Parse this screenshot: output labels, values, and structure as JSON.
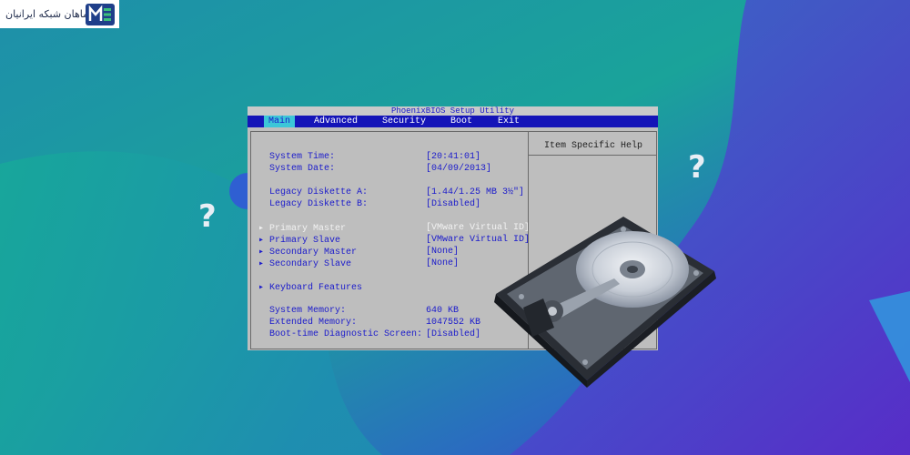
{
  "logo": {
    "text": "ماهان شبکه ایرانیان"
  },
  "bios": {
    "title": "PhoenixBIOS Setup Utility",
    "menu": [
      "Main",
      "Advanced",
      "Security",
      "Boot",
      "Exit"
    ],
    "help_title": "Item Specific Help",
    "rows": [
      {
        "label": "System Time:",
        "value": "[20:41:01]"
      },
      {
        "label": "System Date:",
        "value": "[04/09/2013]"
      },
      {
        "label": "Legacy Diskette A:",
        "value": "[1.44/1.25 MB  3½\"]"
      },
      {
        "label": "Legacy Diskette B:",
        "value": "[Disabled]"
      },
      {
        "label": "Primary Master",
        "value": "[VMware Virtual ID]"
      },
      {
        "label": "Primary Slave",
        "value": "[VMware Virtual ID]"
      },
      {
        "label": "Secondary Master",
        "value": "[None]"
      },
      {
        "label": "Secondary Slave",
        "value": "[None]"
      },
      {
        "label": "Keyboard Features",
        "value": ""
      },
      {
        "label": "System Memory:",
        "value": "640 KB"
      },
      {
        "label": "Extended Memory:",
        "value": "1047552 KB"
      },
      {
        "label": "Boot-time Diagnostic Screen:",
        "value": "[Disabled]"
      }
    ]
  },
  "colors": {
    "bios_blue": "#1414b8",
    "menu_active": "#3cc6d8",
    "bios_gray": "#bebebe",
    "bg_teal": "#1aa59a",
    "bg_purple": "#5a2fc4"
  },
  "icons": [
    "question-mark-icon",
    "hard-drive-icon",
    "logo-mark-icon"
  ]
}
